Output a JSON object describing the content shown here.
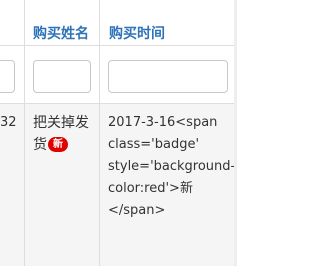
{
  "table": {
    "columns": [
      {
        "key": "buyer_name",
        "label": "购买姓名"
      },
      {
        "key": "purchase_time",
        "label": "购买时间"
      }
    ],
    "filters": {
      "buyer_name": "",
      "purchase_time": ""
    },
    "rows": [
      {
        "truncated_prev_cell": "32",
        "buyer_name_line1": "把关掉发",
        "buyer_name_line2": "货",
        "buyer_name_badge": "新",
        "purchase_time_lines": [
          "2017-3-16<span",
          "class='badge'",
          "style='background-",
          "color:red'>新",
          "</span>"
        ]
      }
    ]
  },
  "colors": {
    "header_text": "#2e73b8",
    "row_background": "#f5f5f5",
    "badge_background": "#e00000",
    "grid_line": "#dddddd"
  }
}
